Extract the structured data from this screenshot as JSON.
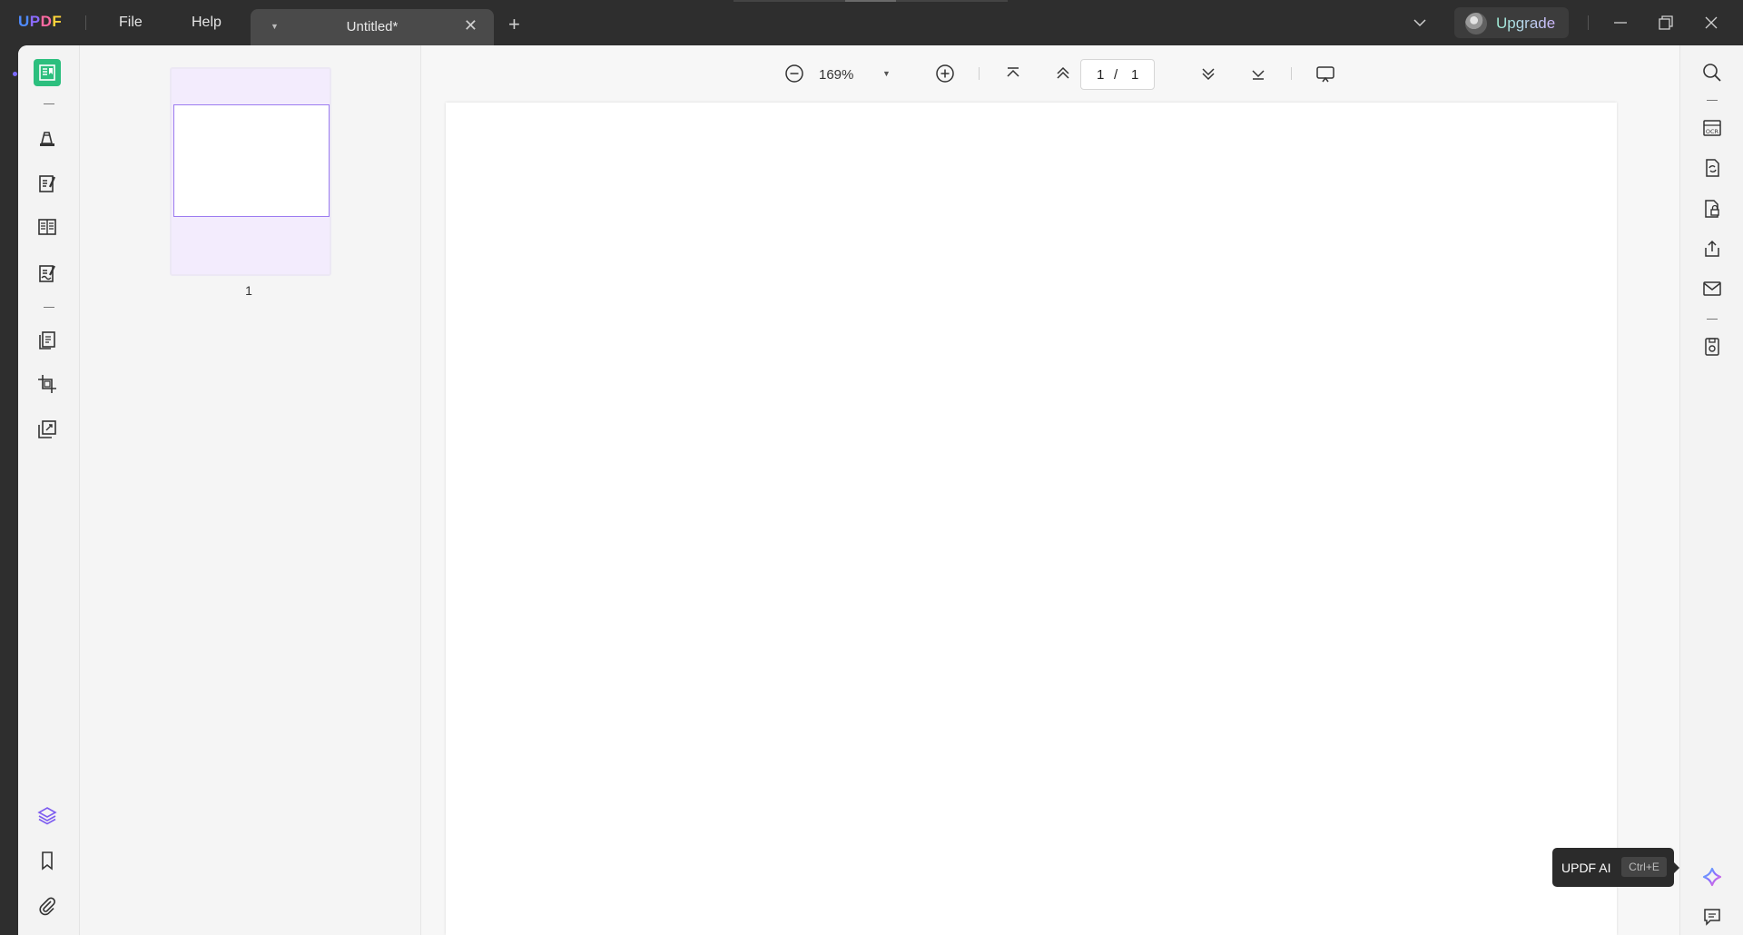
{
  "app": {
    "logo": [
      "U",
      "P",
      "D",
      "F"
    ],
    "menu": {
      "file": "File",
      "help": "Help"
    },
    "tab": {
      "title": "Untitled*"
    },
    "upgrade_label": "Upgrade"
  },
  "toolbar": {
    "zoom": "169%",
    "current_page": "1",
    "page_separator": "/",
    "total_pages": "1"
  },
  "thumbnails": [
    {
      "number": "1"
    }
  ],
  "tooltip": {
    "label": "UPDF AI",
    "shortcut": "Ctrl+E"
  },
  "colors": {
    "accent_green": "#2cbf7e",
    "thumb_border": "#9c7cf0",
    "titlebar": "#2e2e2e"
  },
  "icons": {
    "left_rail": [
      "reader-icon",
      "comment-highlighter-icon",
      "edit-pdf-icon",
      "form-icon",
      "fill-sign-icon",
      "organize-pages-icon",
      "crop-icon",
      "tools-icon",
      "layers-icon",
      "bookmark-icon",
      "attachment-icon"
    ],
    "right_rail": [
      "search-icon",
      "ocr-icon",
      "convert-icon",
      "protect-icon",
      "share-icon",
      "email-icon",
      "save-icon",
      "updf-ai-icon",
      "chat-icon"
    ]
  }
}
